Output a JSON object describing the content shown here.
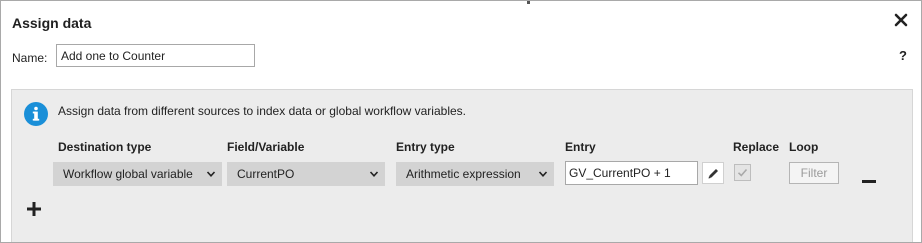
{
  "dialog": {
    "title": "Assign data",
    "help_label": "?",
    "name_label": "Name:",
    "name_value": "Add one to Counter"
  },
  "info": {
    "text": "Assign data from different sources to index data or global workflow variables."
  },
  "columns": {
    "destination_type": "Destination type",
    "field_variable": "Field/Variable",
    "entry_type": "Entry type",
    "entry": "Entry",
    "replace": "Replace",
    "loop": "Loop"
  },
  "row": {
    "destination_type": "Workflow global variable",
    "field_variable": "CurrentPO",
    "entry_type": "Arithmetic expression",
    "entry_value": "GV_CurrentPO + 1",
    "replace_checked": true,
    "replace_disabled": true,
    "loop_filter_label": "Filter"
  },
  "icons": {
    "close": "close-icon",
    "info": "info-icon",
    "chevron": "chevron-down-icon",
    "edit": "pencil-icon",
    "check": "check-icon",
    "remove": "minus-icon",
    "add": "plus-icon"
  },
  "colors": {
    "info_blue": "#1a8fd8",
    "panel_bg": "#ececec",
    "select_bg": "#d3d3d3"
  }
}
